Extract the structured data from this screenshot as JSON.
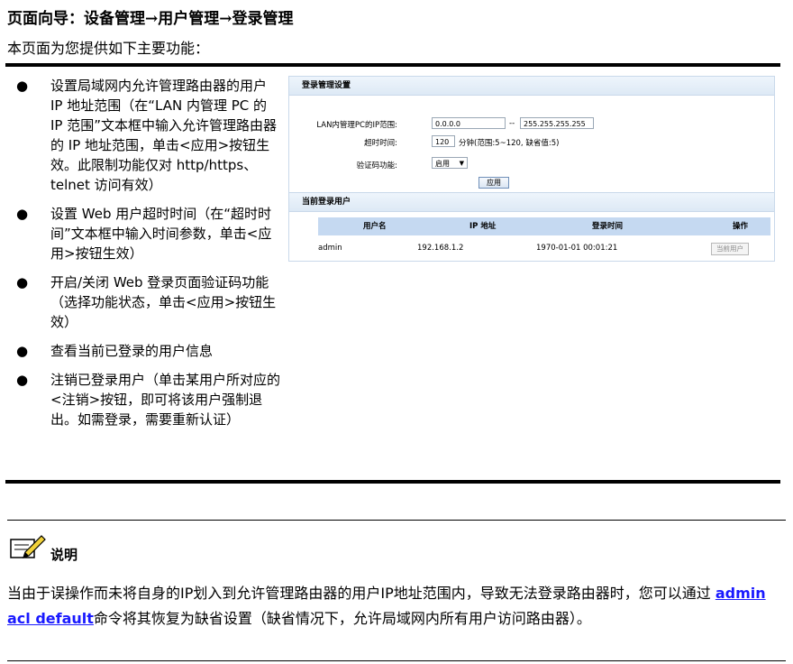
{
  "header": {
    "nav_path": "页面向导：设备管理→用户管理→登录管理",
    "intro": "本页面为您提供如下主要功能："
  },
  "bullets": [
    "设置局域网内允许管理路由器的用户 IP 地址范围（在“LAN 内管理 PC 的 IP 范围”文本框中输入允许管理路由器的 IP 地址范围，单击<应用>按钮生效。此限制功能仅对 http/https、telnet 访问有效）",
    "设置 Web 用户超时时间（在“超时时间”文本框中输入时间参数，单击<应用>按钮生效）",
    "开启/关闭 Web 登录页面验证码功能（选择功能状态，单击<应用>按钮生效）",
    "查看当前已登录的用户信息",
    "注销已登录用户（单击某用户所对应的<注销>按钮，即可将该用户强制退出。如需登录，需要重新认证）"
  ],
  "panel": {
    "settings_title": "登录管理设置",
    "ip_range_label": "LAN内管理PC的IP范围:",
    "ip_start": "0.0.0.0",
    "ip_sep": "--",
    "ip_end": "255.255.255.255",
    "timeout_label": "超时时间:",
    "timeout_value": "120",
    "timeout_hint": "分钟(范围:5~120, 缺省值:5)",
    "captcha_label": "验证码功能:",
    "captcha_value": "启用",
    "apply_button": "应用",
    "users_title": "当前登录用户",
    "columns": [
      "用户名",
      "IP 地址",
      "登录时间",
      "操作"
    ],
    "rows": [
      {
        "username": "admin",
        "ip": "192.168.1.2",
        "login_time": "1970-01-01 00:01:21",
        "action": "当前用户"
      }
    ]
  },
  "note": {
    "title": "说明",
    "text_before": "当由于误操作而未将自身的IP划入到允许管理路由器的用户IP地址范围内，导致无法登录路由器时，您可以通过 ",
    "command": "admin acl default",
    "text_after": "命令将其恢复为缺省设置（缺省情况下，允许局域网内所有用户访问路由器）。"
  }
}
